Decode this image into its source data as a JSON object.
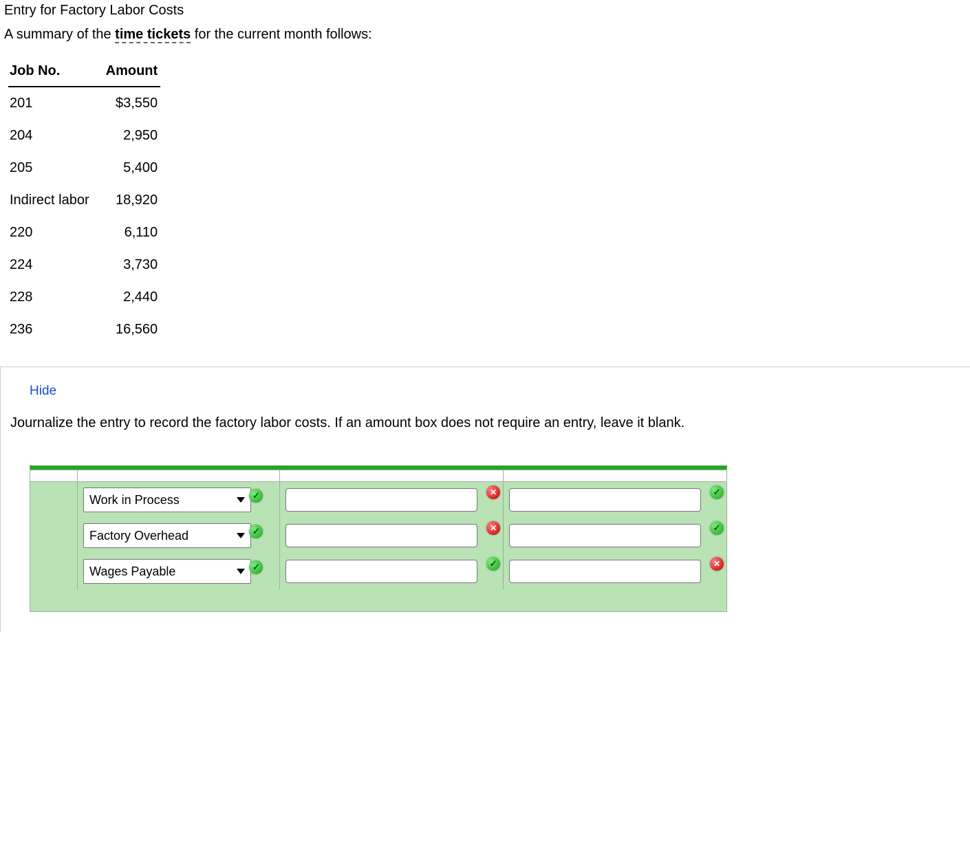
{
  "title": "Entry for Factory Labor Costs",
  "intro": {
    "before": "A summary of the ",
    "term": "time tickets",
    "after": " for the current month follows:"
  },
  "table": {
    "headers": {
      "job": "Job No.",
      "amount": "Amount"
    },
    "rows": [
      {
        "job": "201",
        "amount": "$3,550"
      },
      {
        "job": "204",
        "amount": "2,950"
      },
      {
        "job": "205",
        "amount": "5,400"
      },
      {
        "job": "Indirect labor",
        "amount": "18,920"
      },
      {
        "job": "220",
        "amount": "6,110"
      },
      {
        "job": "224",
        "amount": "3,730"
      },
      {
        "job": "228",
        "amount": "2,440"
      },
      {
        "job": "236",
        "amount": "16,560"
      }
    ]
  },
  "panel": {
    "hide": "Hide",
    "instructions": "Journalize the entry to record the factory labor costs. If an amount box does not require an entry, leave it blank."
  },
  "journal": {
    "rows": [
      {
        "account": "Work in Process",
        "account_status": "ok",
        "debit": "",
        "debit_status": "err",
        "credit": "",
        "credit_status": "ok"
      },
      {
        "account": "Factory Overhead",
        "account_status": "ok",
        "debit": "",
        "debit_status": "err",
        "credit": "",
        "credit_status": "ok"
      },
      {
        "account": "Wages Payable",
        "account_status": "ok",
        "debit": "",
        "debit_status": "ok",
        "credit": "",
        "credit_status": "err"
      }
    ]
  }
}
